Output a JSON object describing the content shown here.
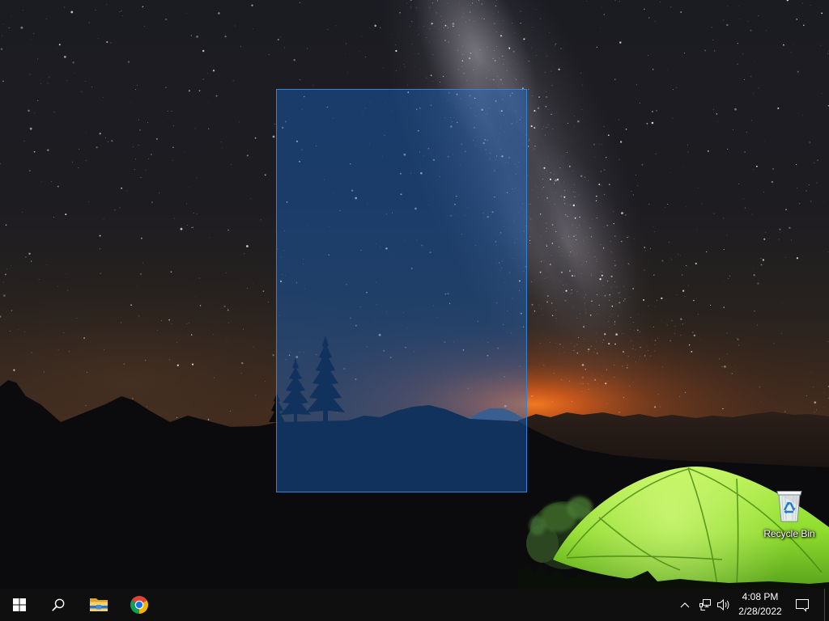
{
  "desktop": {
    "icons": [
      {
        "label": "Recycle Bin",
        "icon": "recycle-bin-icon"
      }
    ],
    "selection_rectangle": {
      "visible": true
    }
  },
  "taskbar": {
    "start_button": {
      "icon": "windows-logo-icon"
    },
    "search_button": {
      "icon": "search-icon"
    },
    "pinned_apps": [
      {
        "icon": "file-explorer-icon"
      },
      {
        "icon": "chrome-icon"
      }
    ],
    "tray": {
      "overflow_icon": "chevron-up-icon",
      "network_icon": "network-icon",
      "volume_icon": "volume-icon",
      "time": "4:08 PM",
      "date": "2/28/2022",
      "notifications_icon": "action-center-icon"
    }
  },
  "colors": {
    "selection_border": "#2f84da",
    "selection_fill": "#1a6fd666",
    "taskbar_background": "#0f0f10",
    "icon_label_text": "#ffffff",
    "tent_light": "#b8f252",
    "tent_dark": "#5aa51c",
    "horizon_glow": "#f07a22"
  }
}
